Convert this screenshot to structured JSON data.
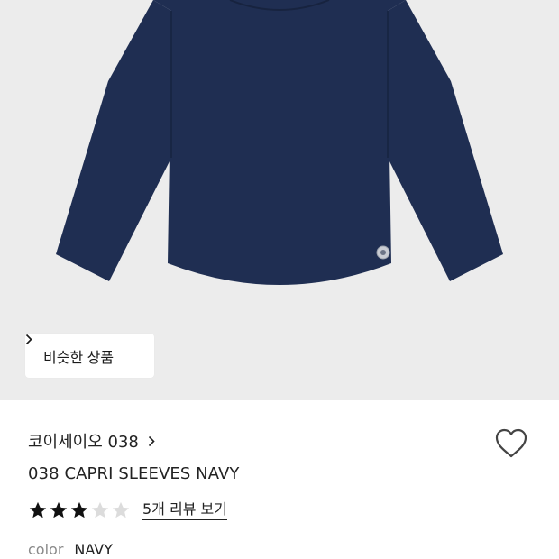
{
  "product": {
    "image_alt": "navy long-sleeve t-shirt",
    "similar_button_label": "비슷한 상품",
    "brand": "코이세이오 038",
    "title": "038 CAPRI SLEEVES NAVY",
    "rating_stars": 3,
    "rating_max": 5,
    "review_link_label": "5개 리뷰 보기",
    "color_label": "color",
    "color_value": "NAVY"
  },
  "colors": {
    "image_background": "#ececec",
    "shirt": "#1f2e52",
    "star_filled": "#111111",
    "star_empty": "#dcdcdc"
  }
}
